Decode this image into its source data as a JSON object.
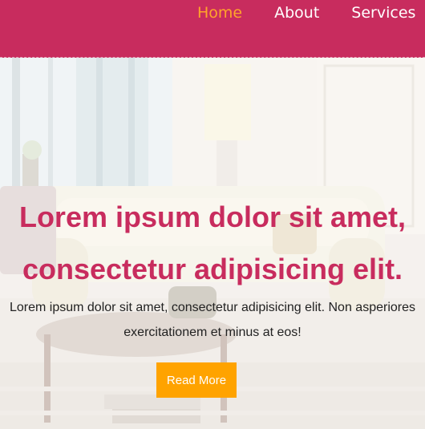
{
  "nav": {
    "items": [
      {
        "label": "Home",
        "active": true
      },
      {
        "label": "About",
        "active": false
      },
      {
        "label": "Services",
        "active": false
      }
    ]
  },
  "hero": {
    "title_line1": "Lorem ipsum dolor sit amet,",
    "title_line2": "consectetur adipisicing elit.",
    "text_line1": "Lorem ipsum dolor sit amet, consectetur adipisicing elit. Non asperiores",
    "text_line2": "exercitationem et minus at eos!",
    "button_label": "Read More"
  },
  "colors": {
    "brand": "#c82c5e",
    "accent": "#ffa300",
    "nav_active": "#ffa42a"
  }
}
